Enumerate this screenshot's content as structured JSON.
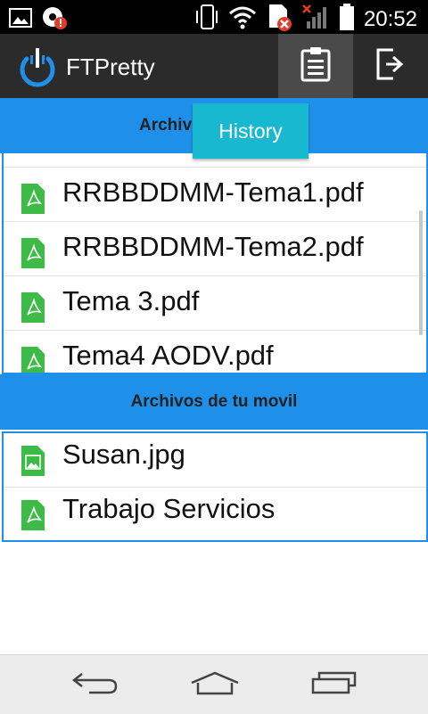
{
  "status_bar": {
    "time": "20:52",
    "icons": [
      "image-icon",
      "alert-app-icon",
      "vibrate-icon",
      "wifi-icon",
      "sim-error-icon",
      "signal-off-icon",
      "battery-icon"
    ]
  },
  "action_bar": {
    "title": "FTPretty",
    "buttons": [
      {
        "name": "clipboard-icon",
        "active": true
      },
      {
        "name": "logout-icon",
        "active": false
      }
    ]
  },
  "tooltip": {
    "label": "History"
  },
  "server_section": {
    "header": "Archivos del servidor",
    "header_visible": "Archiv",
    "files": [
      {
        "name": "RRBBDDMM-Tema1.pdf",
        "icon": "pdf-file-icon"
      },
      {
        "name": "RRBBDDMM-Tema2.pdf",
        "icon": "pdf-file-icon"
      },
      {
        "name": "Tema 3.pdf",
        "icon": "pdf-file-icon"
      },
      {
        "name": "Tema4 AODV.pdf",
        "icon": "pdf-file-icon"
      }
    ]
  },
  "local_section": {
    "header": "Archivos de tu movil",
    "files": [
      {
        "name": "Susan.jpg",
        "icon": "image-file-icon"
      },
      {
        "name": "Trabajo Servicios",
        "icon": "pdf-file-icon"
      }
    ]
  },
  "nav_bar": {
    "buttons": [
      "back-icon",
      "home-icon",
      "recent-apps-icon"
    ]
  },
  "colors": {
    "accent": "#1e90ea",
    "tooltip": "#18b8d0",
    "action_bar": "#2b2b2b",
    "file_icon": "#3dbb46"
  }
}
